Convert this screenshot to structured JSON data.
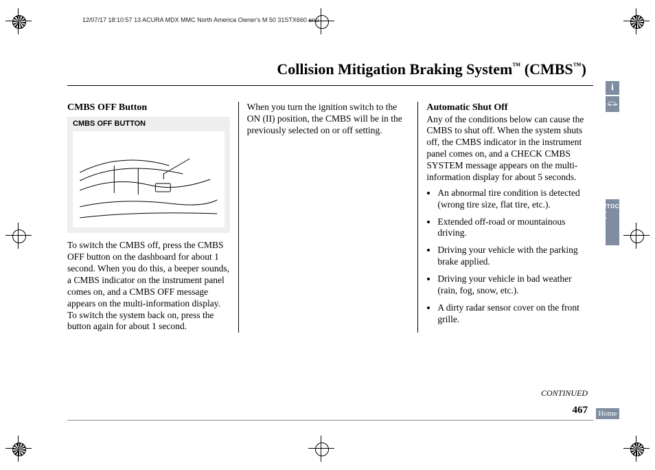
{
  "header_line": "12/07/17 18:10:57   13 ACURA MDX MMC North America Owner's M 50 31STX660 enu",
  "title_pre": "Collision Mitigation Braking System",
  "title_abbr": " (CMBS",
  "title_close": ")",
  "tm": "™",
  "col1": {
    "subhead": "CMBS OFF Button",
    "fig_caption": "CMBS OFF BUTTON",
    "body": "To switch the CMBS off, press the CMBS OFF button on the dashboard for about 1 second. When you do this, a beeper sounds, a CMBS indicator on the instrument panel comes on, and a CMBS OFF message appears on the multi-information display. To switch the system back on, press the button again for about 1 second."
  },
  "col2": {
    "body": "When you turn the ignition switch to the ON (II) position, the CMBS will be in the previously selected on or off setting."
  },
  "col3": {
    "subhead": "Automatic Shut Off",
    "intro": "Any of the conditions below can cause the CMBS to shut off. When the system shuts off, the CMBS indicator in the instrument panel comes on, and a CHECK CMBS SYSTEM message appears on the multi-information display for about 5 seconds.",
    "bullets": [
      "An abnormal tire condition is detected (wrong tire size, flat tire, etc.).",
      "Extended off-road or mountainous driving.",
      "Driving your vehicle with the parking brake applied.",
      "Driving your vehicle in bad weather (rain, fog, snow, etc.).",
      "A dirty radar sensor cover on the front grille."
    ]
  },
  "continued": "CONTINUED",
  "page_number": "467",
  "side": {
    "info": "i",
    "toc": "TOC",
    "section": "Driving",
    "home": "Home"
  }
}
